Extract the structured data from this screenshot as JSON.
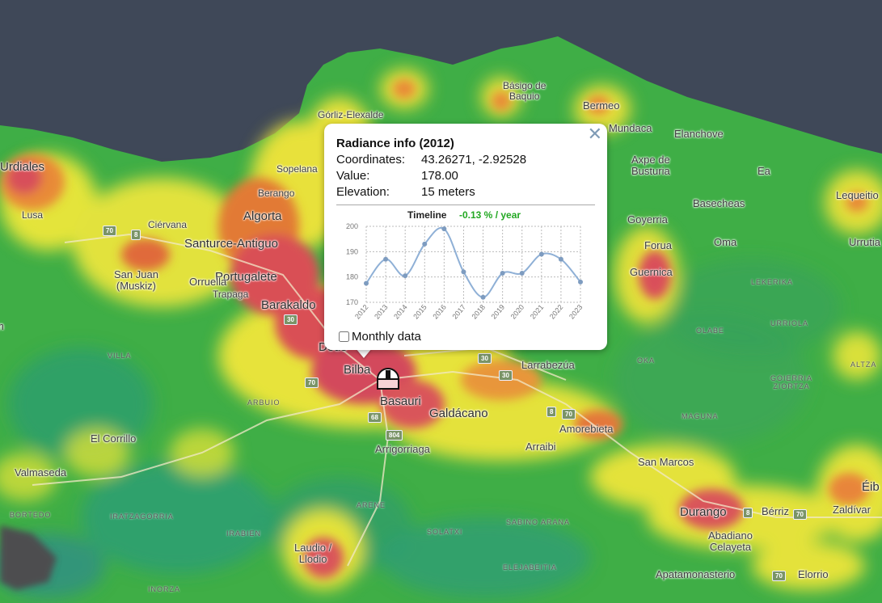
{
  "map": {
    "places": [
      {
        "name": "Básigo de\nBaquio",
        "cls": "small center"
      },
      {
        "name": "Bermeo",
        "cls": "mid"
      },
      {
        "name": "Górliz-Elexalde",
        "cls": "small"
      },
      {
        "name": "Mundaca",
        "cls": "mid"
      },
      {
        "name": "Elanchove",
        "cls": "mid"
      },
      {
        "name": "Axpe de\nBusturia",
        "cls": "mid"
      },
      {
        "name": "Ea",
        "cls": "mid"
      },
      {
        "name": "-Urdiales",
        "cls": "big"
      },
      {
        "name": "Sopelana",
        "cls": "small"
      },
      {
        "name": "Berango",
        "cls": "small"
      },
      {
        "name": "Lequeitio",
        "cls": "mid"
      },
      {
        "name": "Basecheas",
        "cls": "mid"
      },
      {
        "name": "Lusa",
        "cls": "small"
      },
      {
        "name": "Algorta",
        "cls": "big"
      },
      {
        "name": "Goyerria",
        "cls": "mid"
      },
      {
        "name": "Ciérvana",
        "cls": "small"
      },
      {
        "name": "Forua",
        "cls": "mid"
      },
      {
        "name": "Santurce-Antiguo",
        "cls": "big"
      },
      {
        "name": "Oma",
        "cls": "mid"
      },
      {
        "name": "Urrutia",
        "cls": "mid"
      },
      {
        "name": "San Juan\n(Muskiz)",
        "cls": "mid center"
      },
      {
        "name": "Portugalete",
        "cls": "big"
      },
      {
        "name": "Orruella",
        "cls": "mid"
      },
      {
        "name": "Guernica",
        "cls": "mid"
      },
      {
        "name": "Trapaga",
        "cls": "small"
      },
      {
        "name": "Barakaldo",
        "cls": "big"
      },
      {
        "name": "m",
        "cls": "mid"
      },
      {
        "name": "Deus",
        "cls": "big"
      },
      {
        "name": "Bilba",
        "cls": "big"
      },
      {
        "name": "Larrabezúa",
        "cls": "mid"
      },
      {
        "name": "Basauri",
        "cls": "big"
      },
      {
        "name": "Galdácano",
        "cls": "big"
      },
      {
        "name": "Amorebieta",
        "cls": "mid"
      },
      {
        "name": "El Corrillo",
        "cls": "mid"
      },
      {
        "name": "Arrigorriaga",
        "cls": "mid"
      },
      {
        "name": "Arraibi",
        "cls": "mid"
      },
      {
        "name": "San Marcos",
        "cls": "mid"
      },
      {
        "name": "Valmaseda",
        "cls": "mid"
      },
      {
        "name": "Éib",
        "cls": "big"
      },
      {
        "name": "Durango",
        "cls": "big"
      },
      {
        "name": "Bérriz",
        "cls": "mid"
      },
      {
        "name": "Zaldívar",
        "cls": "mid"
      },
      {
        "name": "Abadiano\nCelayeta",
        "cls": "mid center"
      },
      {
        "name": "Laudio /\nLlodio",
        "cls": "mid center"
      },
      {
        "name": "Apatamonasterio",
        "cls": "mid"
      },
      {
        "name": "Elorrio",
        "cls": "mid"
      }
    ],
    "districts": [
      "LEKERIKA",
      "URRIOLA",
      "OLABE",
      "OKA",
      "GOIERRIA\nZIORTZA",
      "ALTZA",
      "MAGUNA",
      "VILLA",
      "ARBUIO",
      "BORTEDO",
      "IRATZAGORRIA",
      "IRABIEN",
      "ARENE",
      "SOLATXI",
      "SABINO ARANA",
      "ELEJABEITIA",
      "INORZA"
    ],
    "road_shields": [
      "70",
      "8",
      "30",
      "30",
      "30",
      "70",
      "68",
      "804",
      "8",
      "70",
      "8",
      "70",
      "70"
    ],
    "marker_icon": "observatory-icon"
  },
  "popup": {
    "title": "Radiance info (2012)",
    "coordinates_label": "Coordinates:",
    "coordinates_value": "43.26271, -2.92528",
    "value_label": "Value:",
    "value_value": "178.00",
    "elevation_label": "Elevation:",
    "elevation_value": "15 meters",
    "close_icon": "close-icon",
    "monthly_label": "Monthly data",
    "monthly_checked": false
  },
  "chart_data": {
    "type": "line",
    "title": "Timeline",
    "trend": "-0.13 % / year",
    "trend_color": "#22a822",
    "line_color": "#8fb0d6",
    "x": [
      "2012",
      "2013",
      "2014",
      "2015",
      "2016",
      "2017",
      "2018",
      "2019",
      "2020",
      "2021",
      "2022",
      "2023"
    ],
    "values": [
      177.5,
      187,
      180.5,
      193,
      199,
      182,
      172,
      181.5,
      181.5,
      189,
      187,
      178
    ],
    "ylim": [
      170,
      200
    ],
    "yticks": [
      170,
      180,
      190,
      200
    ],
    "grid": true
  }
}
